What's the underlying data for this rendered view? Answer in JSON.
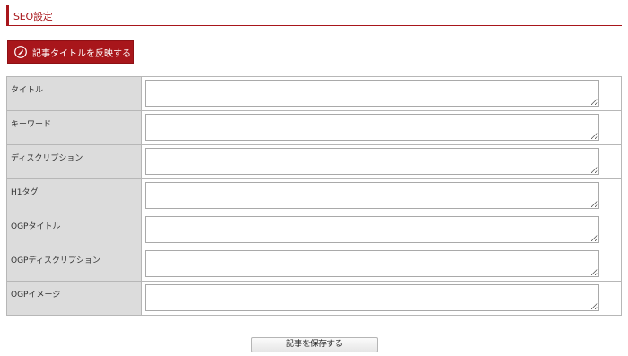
{
  "header": {
    "title": "SEO設定"
  },
  "reflect_button": {
    "label": "記事タイトルを反映する",
    "icon": "tag-icon"
  },
  "fields": [
    {
      "label": "タイトル",
      "value": ""
    },
    {
      "label": "キーワード",
      "value": ""
    },
    {
      "label": "ディスクリプション",
      "value": ""
    },
    {
      "label": "H1タグ",
      "value": ""
    },
    {
      "label": "OGPタイトル",
      "value": ""
    },
    {
      "label": "OGPディスクリプション",
      "value": ""
    },
    {
      "label": "OGPイメージ",
      "value": ""
    }
  ],
  "save_button": {
    "label": "記事を保存する"
  },
  "colors": {
    "accent": "#a8161b",
    "label_bg": "#dcdcdc",
    "border": "#b7b7b7"
  }
}
